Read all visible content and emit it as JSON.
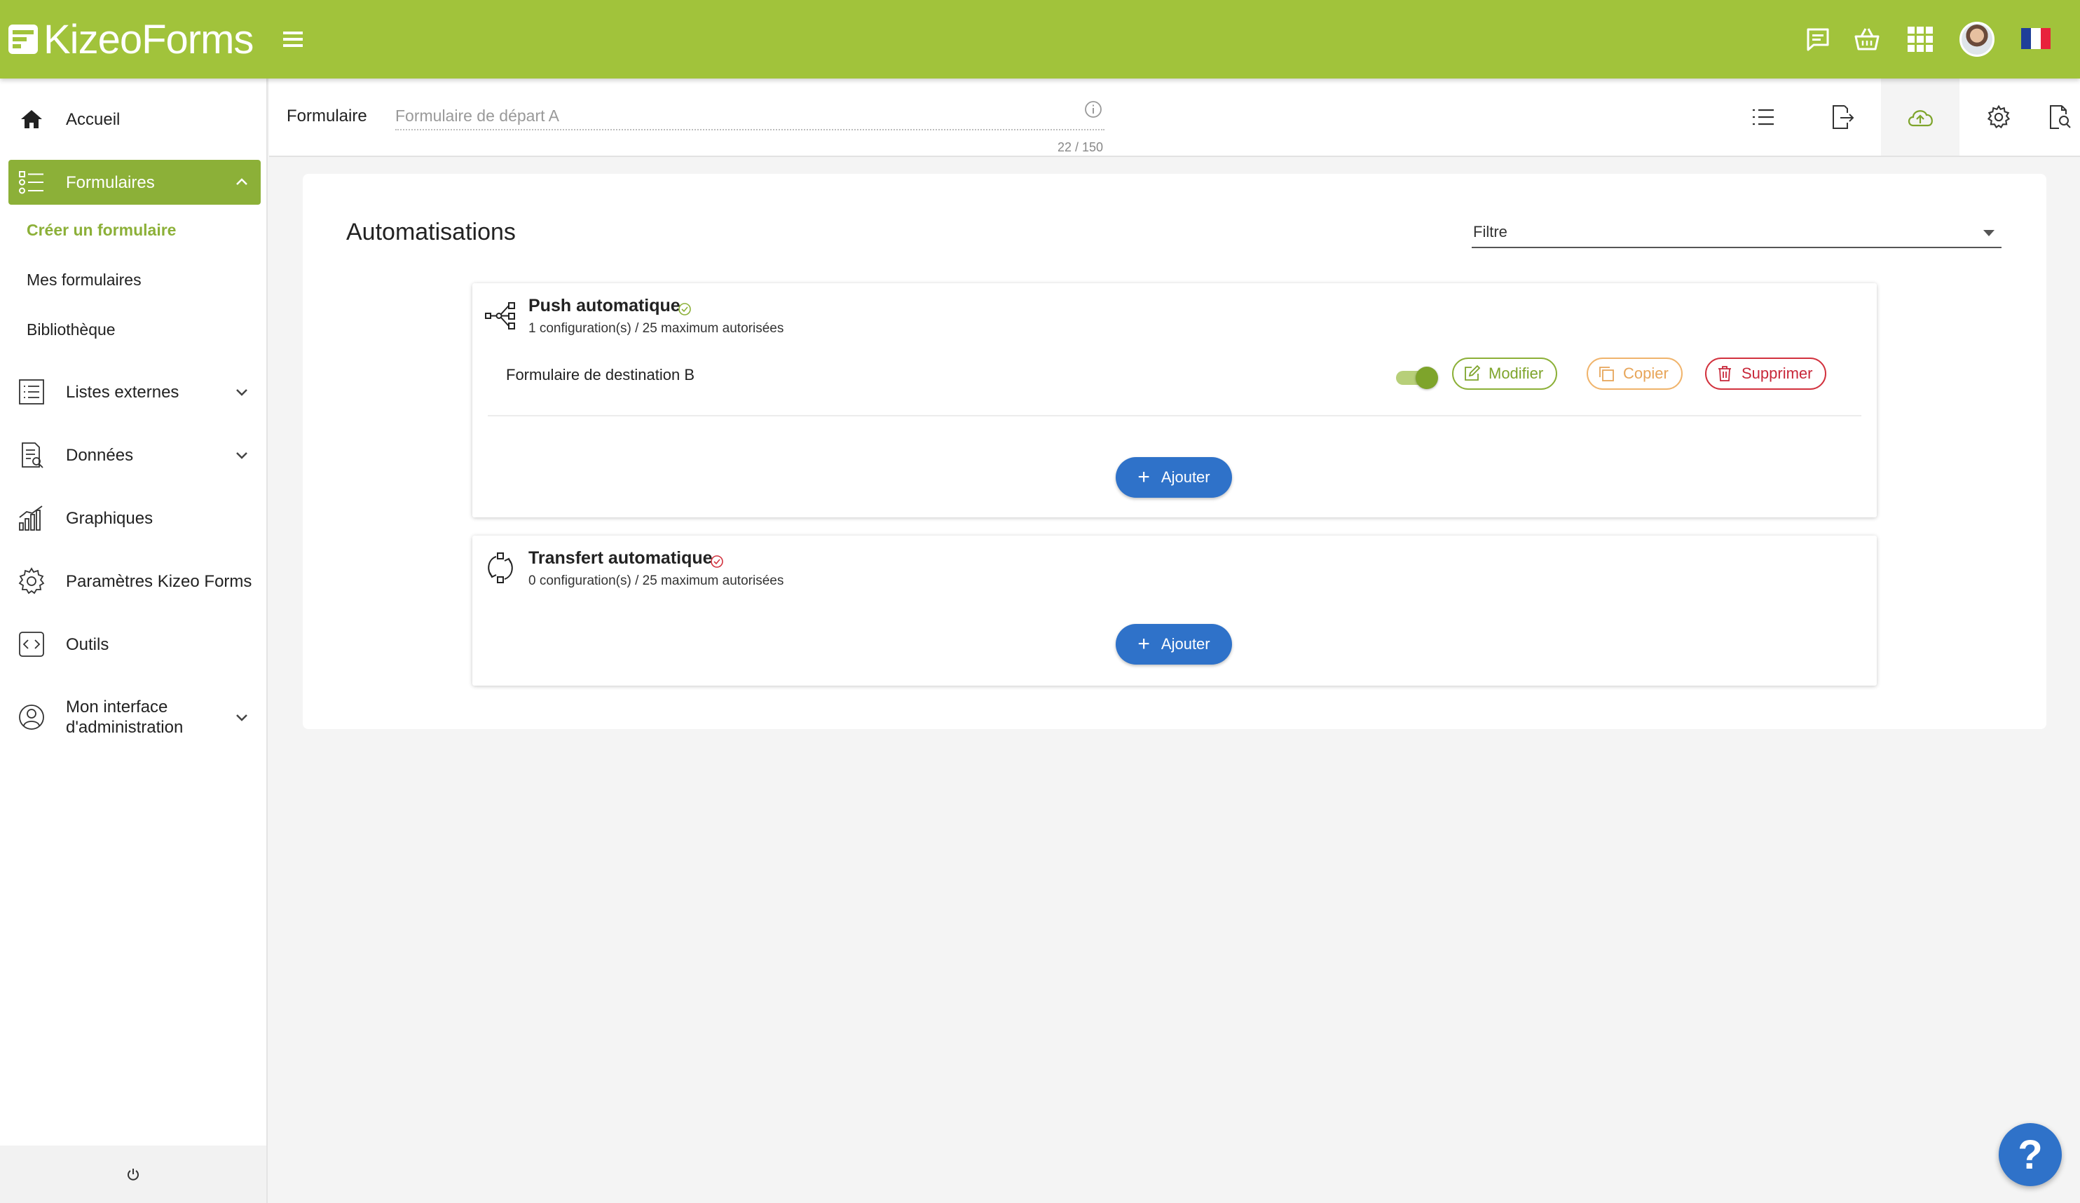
{
  "app": {
    "logo_text": "KizeoForms",
    "brand_color": "#a1c33b",
    "accent_blue": "#2f72c9"
  },
  "topbar": {
    "icons": [
      "menu-icon",
      "chat-icon",
      "basket-icon",
      "apps-grid-icon",
      "user-avatar",
      "flag-fr-icon"
    ]
  },
  "sidebar": {
    "items": [
      {
        "label": "Accueil",
        "icon": "home-icon"
      },
      {
        "label": "Formulaires",
        "icon": "forms-list-icon",
        "active": true
      },
      {
        "label": "Listes externes",
        "icon": "list-icon"
      },
      {
        "label": "Données",
        "icon": "data-icon"
      },
      {
        "label": "Graphiques",
        "icon": "chart-icon"
      },
      {
        "label": "Paramètres Kizeo Forms",
        "icon": "gear-icon"
      },
      {
        "label": "Outils",
        "icon": "code-icon"
      },
      {
        "label": "Mon interface d'administration",
        "icon": "admin-icon"
      }
    ],
    "subitems": [
      "Créer un formulaire",
      "Mes formulaires",
      "Bibliothèque"
    ]
  },
  "form_header": {
    "label": "Formulaire",
    "input_placeholder": "Formulaire de départ A",
    "counter": "22 / 150",
    "tools": [
      "list-icon",
      "export-icon",
      "cloud-upload-icon",
      "settings-icon",
      "preview-icon"
    ]
  },
  "main": {
    "title": "Automatisations",
    "filter_label": "Filtre",
    "cards": [
      {
        "title": "Push automatique",
        "subtitle": "1 configuration(s) / 25 maximum autorisées",
        "status": "active",
        "status_color": "#8cb038",
        "configs": [
          {
            "name": "Formulaire de destination B",
            "enabled": true
          }
        ],
        "actions": {
          "edit": "Modifier",
          "copy": "Copier",
          "delete": "Supprimer"
        },
        "add_label": "Ajouter"
      },
      {
        "title": "Transfert automatique",
        "subtitle": "0 configuration(s) / 25 maximum autorisées",
        "status": "inactive",
        "status_color": "#d2323e",
        "add_label": "Ajouter"
      }
    ]
  },
  "help_label": "?"
}
